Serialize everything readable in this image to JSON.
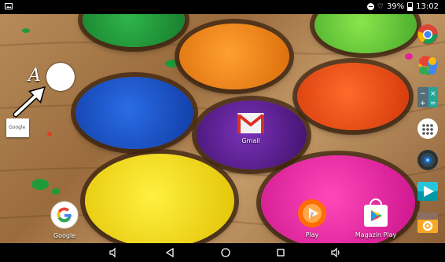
{
  "status_bar": {
    "battery": "39%",
    "time": "13:02"
  },
  "annotation": {
    "letter": "A"
  },
  "widget": {
    "google_search_label": "Google"
  },
  "apps": {
    "gmail": "Gmail",
    "google": "Google",
    "play": "Play",
    "magazin_play": "Magazin Play"
  },
  "colors": {
    "green_powder": "#1f9a3a",
    "lime_powder": "#6fd23a",
    "orange_powder": "#f08a10",
    "red_orange_powder": "#f04a10",
    "blue_powder": "#1a50c8",
    "purple_powder": "#5a1e8c",
    "yellow_powder": "#f2dc10",
    "pink_powder": "#e8209a"
  },
  "icons": [
    "dnd-icon",
    "heart-icon",
    "battery-icon",
    "chrome-icon",
    "photos-icon",
    "calculator-icon",
    "app-drawer-icon",
    "speaker-icon",
    "play-movies-icon",
    "settings-icon",
    "back-nav-icon",
    "home-nav-icon",
    "recents-nav-icon",
    "volume-down-icon",
    "volume-up-icon"
  ]
}
